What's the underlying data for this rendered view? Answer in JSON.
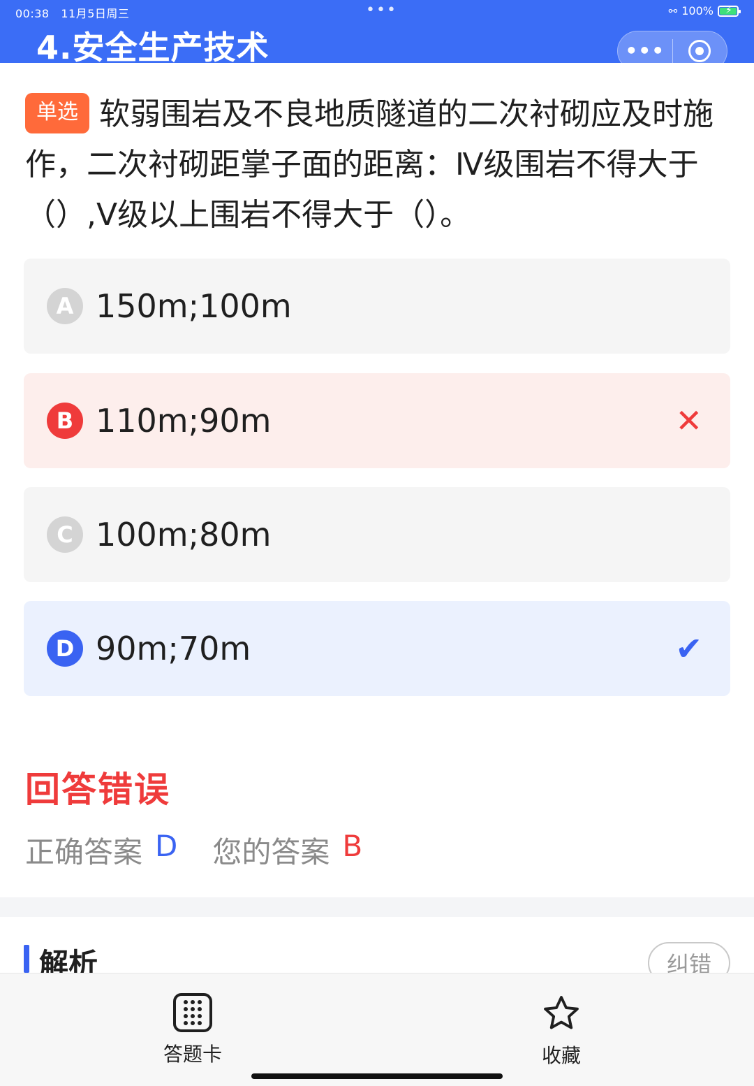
{
  "status_bar": {
    "time": "00:38",
    "date": "11月5日周三",
    "battery": "100%"
  },
  "header": {
    "title": "4.安全生产技术"
  },
  "question": {
    "tag": "单选",
    "text": "软弱围岩及不良地质隧道的二次衬砌应及时施作，二次衬砌距掌子面的距离：Ⅳ级围岩不得大于（）,V级以上围岩不得大于（）。"
  },
  "options": [
    {
      "letter": "A",
      "text": "150m;100m",
      "state": "normal"
    },
    {
      "letter": "B",
      "text": "110m;90m",
      "state": "wrong"
    },
    {
      "letter": "C",
      "text": "100m;80m",
      "state": "normal"
    },
    {
      "letter": "D",
      "text": "90m;70m",
      "state": "correct"
    }
  ],
  "result": {
    "title": "回答错误",
    "correct_label": "正确答案",
    "correct_value": "D",
    "yours_label": "您的答案",
    "yours_value": "B"
  },
  "analysis": {
    "title": "解析",
    "report_label": "纠错"
  },
  "bottom_bar": {
    "answer_card_label": "答题卡",
    "favorite_label": "收藏"
  },
  "colors": {
    "header": "#3b6df6",
    "wrong": "#ef3b3b",
    "correct": "#3a63f2",
    "tag": "#ff6a3a"
  }
}
